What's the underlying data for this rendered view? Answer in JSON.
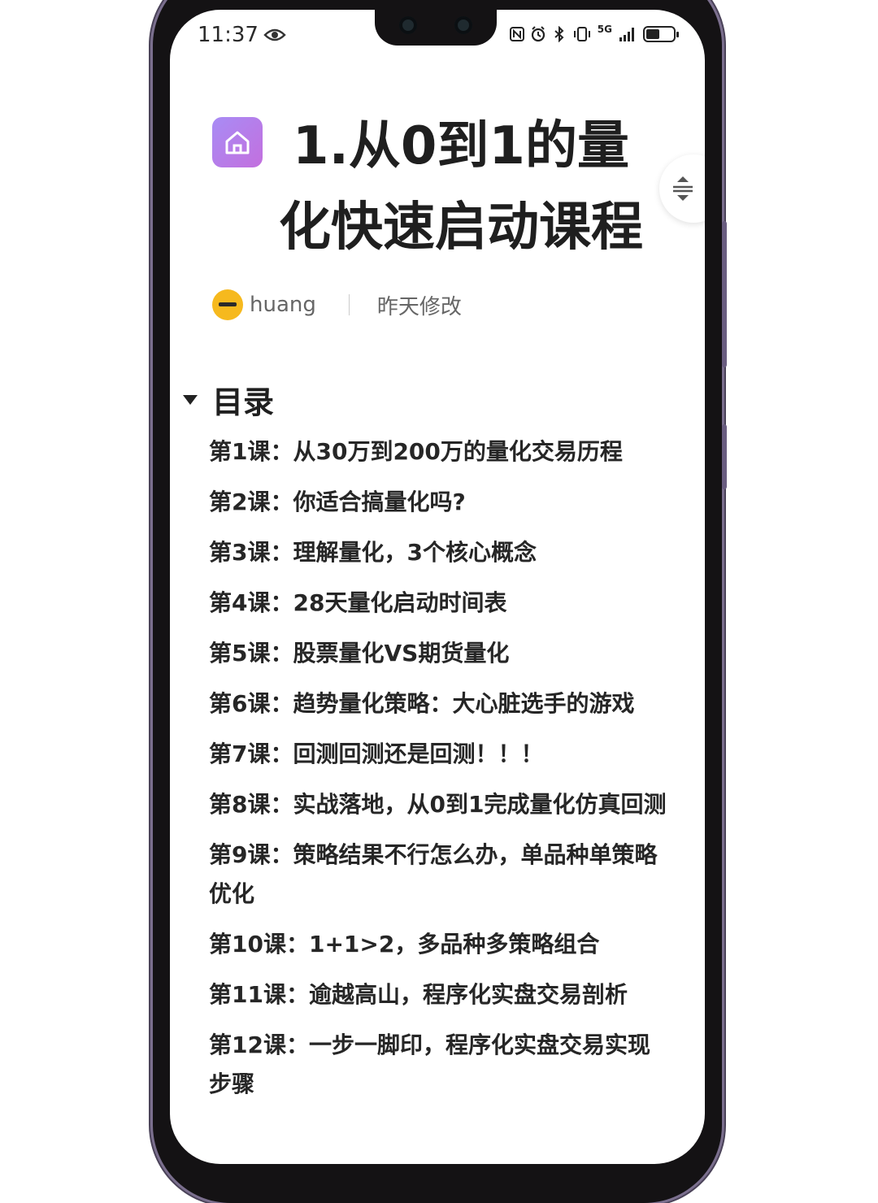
{
  "status_bar": {
    "time": "11:37",
    "network": "5G",
    "battery_level": 0.5
  },
  "document": {
    "title": "1.从0到1的量化快速启动课程",
    "author": "huang",
    "modified": "昨天修改"
  },
  "toc": {
    "title": "目录",
    "items": [
      "第1课：从30万到200万的量化交易历程",
      "第2课：你适合搞量化吗?",
      "第3课：理解量化，3个核心概念",
      "第4课：28天量化启动时间表",
      "第5课：股票量化VS期货量化",
      "第6课：趋势量化策略：大心脏选手的游戏",
      "第7课：回测回测还是回测！！！",
      "第8课：实战落地，从0到1完成量化仿真回测",
      "第9课：策略结果不行怎么办，单品种单策略优化",
      "第10课：1+1>2，多品种多策略组合",
      "第11课：逾越高山，程序化实盘交易剖析",
      "第12课：一步一脚印，程序化实盘交易实现步骤"
    ]
  },
  "icons": {
    "doc": "home-icon",
    "float": "collapse-expand-icon",
    "eye": "eye-icon"
  },
  "colors": {
    "doc_icon_start": "#a88cf5",
    "doc_icon_end": "#c36fde",
    "avatar": "#f6b91e"
  }
}
